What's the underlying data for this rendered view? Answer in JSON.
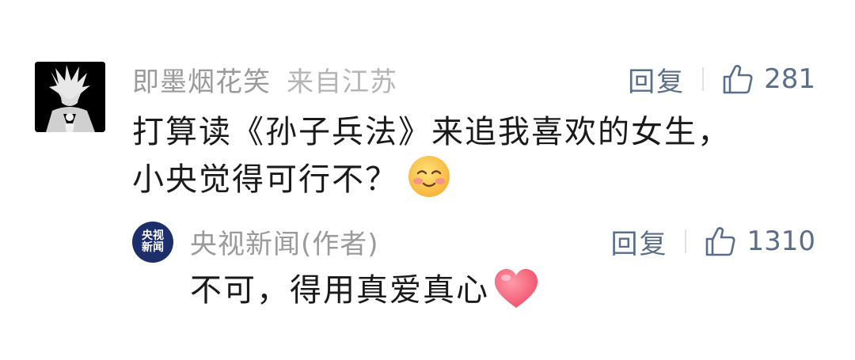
{
  "main_comment": {
    "username": "即墨烟花笑",
    "location": "来自江苏",
    "text_line1": "打算读《孙子兵法》来追我喜欢的女生，",
    "text_line2": "小央觉得可行不？",
    "emoji": "blushing-face-emoji",
    "reply_label": "回复",
    "like_count": "281"
  },
  "reply": {
    "avatar_text_top": "央视",
    "avatar_text_bottom": "新闻",
    "username": "央视新闻(作者)",
    "text": "不可，得用真爱真心",
    "emoji": "heart-emoji",
    "reply_label": "回复",
    "like_count": "1310"
  },
  "colors": {
    "username": "#9a9a9a",
    "action": "#5a6e8a",
    "text": "#1a1a1a",
    "avatar_reply_bg": "#1d2f6b",
    "heart": "#f2607a"
  }
}
